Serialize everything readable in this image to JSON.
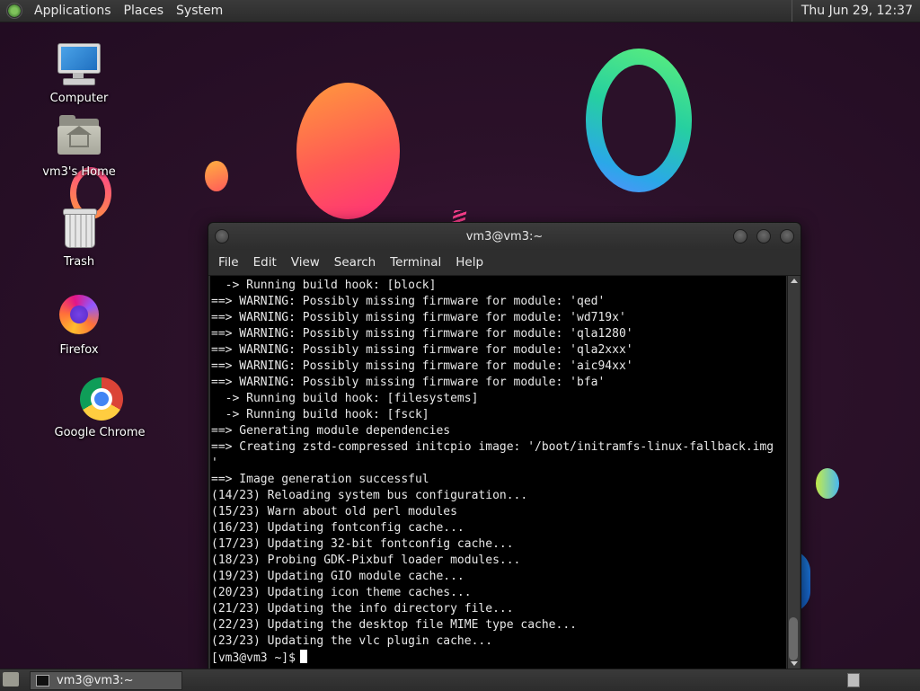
{
  "top_panel": {
    "menus": [
      "Applications",
      "Places",
      "System"
    ],
    "clock": "Thu Jun 29, 12:37"
  },
  "desktop_icons": [
    {
      "label": "Computer",
      "icon": "computer-icon"
    },
    {
      "label": "vm3's Home",
      "icon": "home-folder-icon"
    },
    {
      "label": "Trash",
      "icon": "trash-icon"
    },
    {
      "label": "Firefox",
      "icon": "firefox-icon"
    },
    {
      "label": "Google Chrome",
      "icon": "chrome-icon"
    }
  ],
  "terminal": {
    "title": "vm3@vm3:~",
    "menus": [
      "File",
      "Edit",
      "View",
      "Search",
      "Terminal",
      "Help"
    ],
    "lines": [
      "  -> Running build hook: [block]",
      "==> WARNING: Possibly missing firmware for module: 'qed'",
      "==> WARNING: Possibly missing firmware for module: 'wd719x'",
      "==> WARNING: Possibly missing firmware for module: 'qla1280'",
      "==> WARNING: Possibly missing firmware for module: 'qla2xxx'",
      "==> WARNING: Possibly missing firmware for module: 'aic94xx'",
      "==> WARNING: Possibly missing firmware for module: 'bfa'",
      "  -> Running build hook: [filesystems]",
      "  -> Running build hook: [fsck]",
      "==> Generating module dependencies",
      "==> Creating zstd-compressed initcpio image: '/boot/initramfs-linux-fallback.img",
      "'",
      "==> Image generation successful",
      "(14/23) Reloading system bus configuration...",
      "(15/23) Warn about old perl modules",
      "(16/23) Updating fontconfig cache...",
      "(17/23) Updating 32-bit fontconfig cache...",
      "(18/23) Probing GDK-Pixbuf loader modules...",
      "(19/23) Updating GIO module cache...",
      "(20/23) Updating icon theme caches...",
      "(21/23) Updating the info directory file...",
      "(22/23) Updating the desktop file MIME type cache...",
      "(23/23) Updating the vlc plugin cache..."
    ],
    "prompt": "[vm3@vm3 ~]$"
  },
  "taskbar": {
    "window_label": "vm3@vm3:~"
  }
}
